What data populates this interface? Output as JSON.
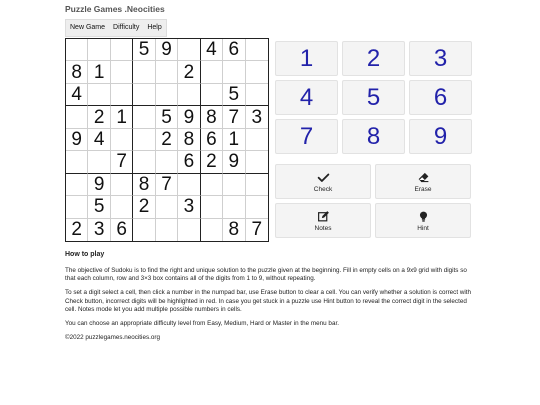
{
  "site": {
    "title": "Puzzle Games .Neocities"
  },
  "menu": [
    "New Game",
    "Difficulty",
    "Help"
  ],
  "board": [
    [
      "",
      "",
      "",
      "5",
      "9",
      "",
      "4",
      "6",
      ""
    ],
    [
      "8",
      "1",
      "",
      "",
      "",
      "2",
      "",
      "",
      ""
    ],
    [
      "4",
      "",
      "",
      "",
      "",
      "",
      "",
      "5",
      ""
    ],
    [
      "",
      "2",
      "1",
      "",
      "5",
      "9",
      "8",
      "7",
      "3"
    ],
    [
      "9",
      "4",
      "",
      "",
      "2",
      "8",
      "6",
      "1",
      ""
    ],
    [
      "",
      "",
      "7",
      "",
      "",
      "6",
      "2",
      "9",
      ""
    ],
    [
      "",
      "9",
      "",
      "8",
      "7",
      "",
      "",
      "",
      ""
    ],
    [
      "",
      "5",
      "",
      "2",
      "",
      "3",
      "",
      "",
      ""
    ],
    [
      "2",
      "3",
      "6",
      "",
      "",
      "",
      "",
      "8",
      "7"
    ]
  ],
  "numpad": [
    "1",
    "2",
    "3",
    "4",
    "5",
    "6",
    "7",
    "8",
    "9"
  ],
  "actions": {
    "check": {
      "label": "Check",
      "icon": "check-icon"
    },
    "erase": {
      "label": "Erase",
      "icon": "eraser-icon"
    },
    "notes": {
      "label": "Notes",
      "icon": "edit-note-icon"
    },
    "hint": {
      "label": "Hint",
      "icon": "lightbulb-icon"
    }
  },
  "colors": {
    "number_pad": "#2222aa"
  },
  "help": {
    "heading": "How to play",
    "p1": "The objective of Sudoku is to find the right and unique solution to the puzzle given at the beginning. Fill in empty cells on a 9x9 grid with digits so that each column, row and 3×3 box contains all of the digits from 1 to 9, without repeating.",
    "p2": "To set a digit select a cell, then click a number in the numpad bar, use Erase button to clear a cell. You can verify whether a solution is correct with Check button, incorrect digits will be highlighted in red. In case you get stuck in a puzzle use Hint button to reveal the correct digit in the selected cell. Notes mode let you add multiple possible numbers in cells.",
    "p3": "You can choose an appropriate difficulty level from Easy, Medium, Hard or Master in the menu bar.",
    "footer": "©2022 puzzlegames.neocities.org"
  }
}
